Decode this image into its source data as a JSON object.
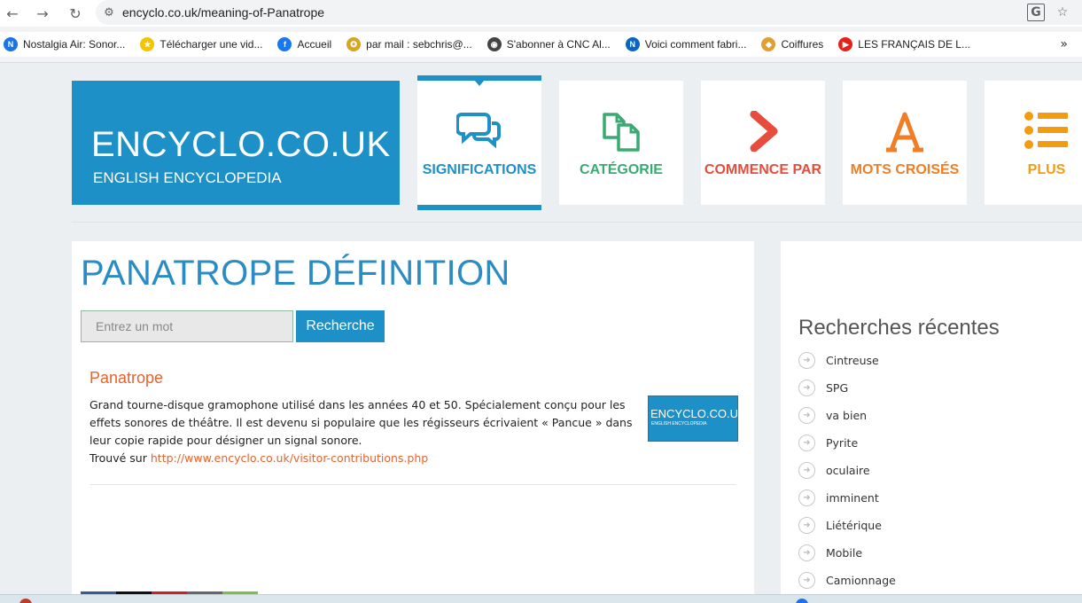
{
  "browser": {
    "url": "encyclo.co.uk/meaning-of-Panatrope",
    "bookmarks": [
      {
        "label": "Nostalgia Air: Sonor...",
        "color": "#1a73e8",
        "glyph": "N"
      },
      {
        "label": "Télécharger une vid...",
        "color": "#f5c400",
        "glyph": "★"
      },
      {
        "label": "Accueil",
        "color": "#1877f2",
        "glyph": "f"
      },
      {
        "label": "par mail : sebchris@...",
        "color": "#d8a520",
        "glyph": "✪"
      },
      {
        "label": "S'abonner à CNC Al...",
        "color": "#444444",
        "glyph": "◉"
      },
      {
        "label": "Voici comment fabri...",
        "color": "#0a66c2",
        "glyph": "N"
      },
      {
        "label": "Coiffures",
        "color": "#e0a030",
        "glyph": "◆"
      },
      {
        "label": "LES FRANÇAIS DE L...",
        "color": "#e62117",
        "glyph": "▶"
      }
    ]
  },
  "site": {
    "logo_title": "ENCYCLO.CO.UK",
    "logo_subtitle": "ENGLISH ENCYCLOPEDIA"
  },
  "nav": [
    {
      "label": "SIGNIFICATIONS",
      "color": "#1e90c8",
      "icon": "chat-bubbles-icon",
      "active": true
    },
    {
      "label": "CATÉGORIE",
      "color": "#3aaa72",
      "icon": "documents-icon",
      "active": false
    },
    {
      "label": "COMMENCE PAR",
      "color": "#e74c3c",
      "icon": "chevron-right-icon",
      "active": false
    },
    {
      "label": "MOTS CROISÉS",
      "color": "#f07e26",
      "icon": "letter-a-icon",
      "active": false
    },
    {
      "label": "PLUS",
      "color": "#f39c12",
      "icon": "list-icon",
      "active": false
    }
  ],
  "main": {
    "title": "PANATROPE DÉFINITION",
    "search_placeholder": "Entrez un mot",
    "search_button": "Recherche",
    "entry": {
      "word": "Panatrope",
      "definition": "Grand tourne-disque gramophone utilisé dans les années 40 et 50. Spécialement conçu pour les effets sonores de théâtre. Il est devenu si populaire que les régisseurs écrivaient « Pancue » dans leur copie rapide pour désigner un signal sonore.",
      "source_prefix": "Trouvé sur",
      "source_link": "http://www.encyclo.co.uk/visitor-contributions.php",
      "thumb_title": "ENCYCLO.CO.UK",
      "thumb_subtitle": "ENGLISH ENCYCLOPEDIA"
    }
  },
  "sidebar": {
    "title": "Recherches récentes",
    "items": [
      "Cintreuse",
      "SPG",
      "va bien",
      "Pyrite",
      "oculaire",
      "imminent",
      "Liétérique",
      "Mobile",
      "Camionnage"
    ]
  },
  "colors": {
    "brand_blue": "#1e90c8",
    "accent_orange": "#e8622b"
  }
}
